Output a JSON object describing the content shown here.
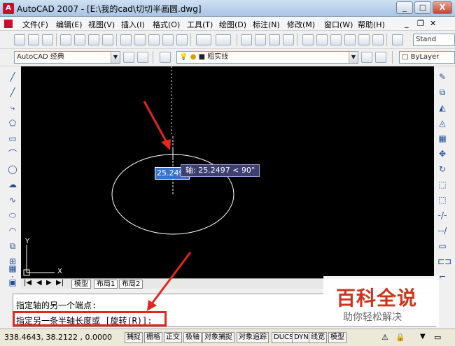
{
  "window": {
    "title": "AutoCAD 2007 - [E:\\我的cad\\切切半画圆.dwg]",
    "app_icon": "A",
    "minimize": "_",
    "maximize": "□",
    "close": "X"
  },
  "menu": {
    "items": [
      "文件(F)",
      "编辑(E)",
      "视图(V)",
      "插入(I)",
      "格式(O)",
      "工具(T)",
      "绘图(D)",
      "标注(N)",
      "修改(M)",
      "窗口(W)",
      "帮助(H)"
    ],
    "right_combo": "Stand"
  },
  "toolbar2": {
    "workspace": "AutoCAD 经典",
    "linetype": "粗实线",
    "color": "ByLayer"
  },
  "canvas": {
    "input_value": "25.2497",
    "tooltip": "轴: 25.2497 < 90°",
    "ucs_y": "Y",
    "ucs_x": "X"
  },
  "tabs": [
    "模型",
    "布局1",
    "布局2"
  ],
  "command": {
    "line1": "指定轴的另一个端点:",
    "line2": "指定另一条半轴长度或 [旋转(R)]:"
  },
  "status": {
    "coords": "338.4643, 38.2122 , 0.0000",
    "buttons": [
      "捕捉",
      "栅格",
      "正交",
      "极轴",
      "对象捕捉",
      "对象追踪",
      "DUCS",
      "DYN",
      "线宽",
      "模型"
    ]
  },
  "watermark": {
    "title": "百科全说",
    "subtitle": "助你轻松解决"
  },
  "colors": {
    "canvas_bg": "#000000",
    "annotation_red": "#e3261e",
    "watermark_red": "#d0331c"
  }
}
